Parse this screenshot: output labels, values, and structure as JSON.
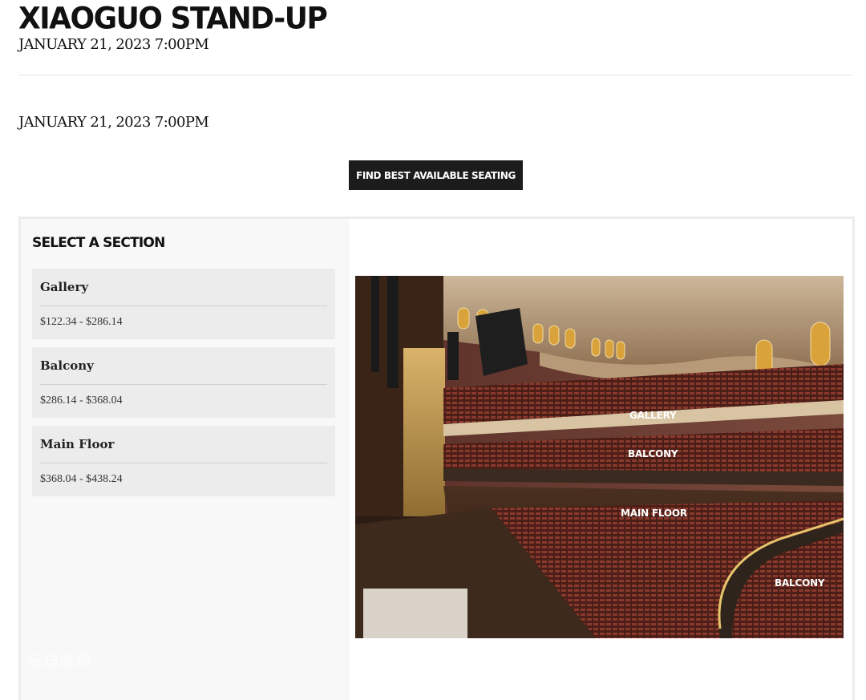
{
  "event": {
    "title": "XIAOGUO STAND-UP",
    "date_header": "JANUARY 21, 2023 7:00PM",
    "date_body": "JANUARY 21, 2023 7:00PM"
  },
  "actions": {
    "find_best_label": "FIND BEST AVAILABLE SEATING"
  },
  "sections_panel": {
    "title": "SELECT A SECTION",
    "sections": [
      {
        "name": "Gallery",
        "price_range": "$122.34 - $286.14"
      },
      {
        "name": "Balcony",
        "price_range": "$286.14 - $368.04"
      },
      {
        "name": "Main Floor",
        "price_range": "$368.04 - $438.24"
      }
    ],
    "watermark": "玩技能师"
  },
  "venue_map": {
    "labels": {
      "gallery": "GALLERY",
      "balcony": "BALCONY",
      "main_floor": "MAIN FLOOR",
      "balcony_side": "BALCONY"
    }
  }
}
